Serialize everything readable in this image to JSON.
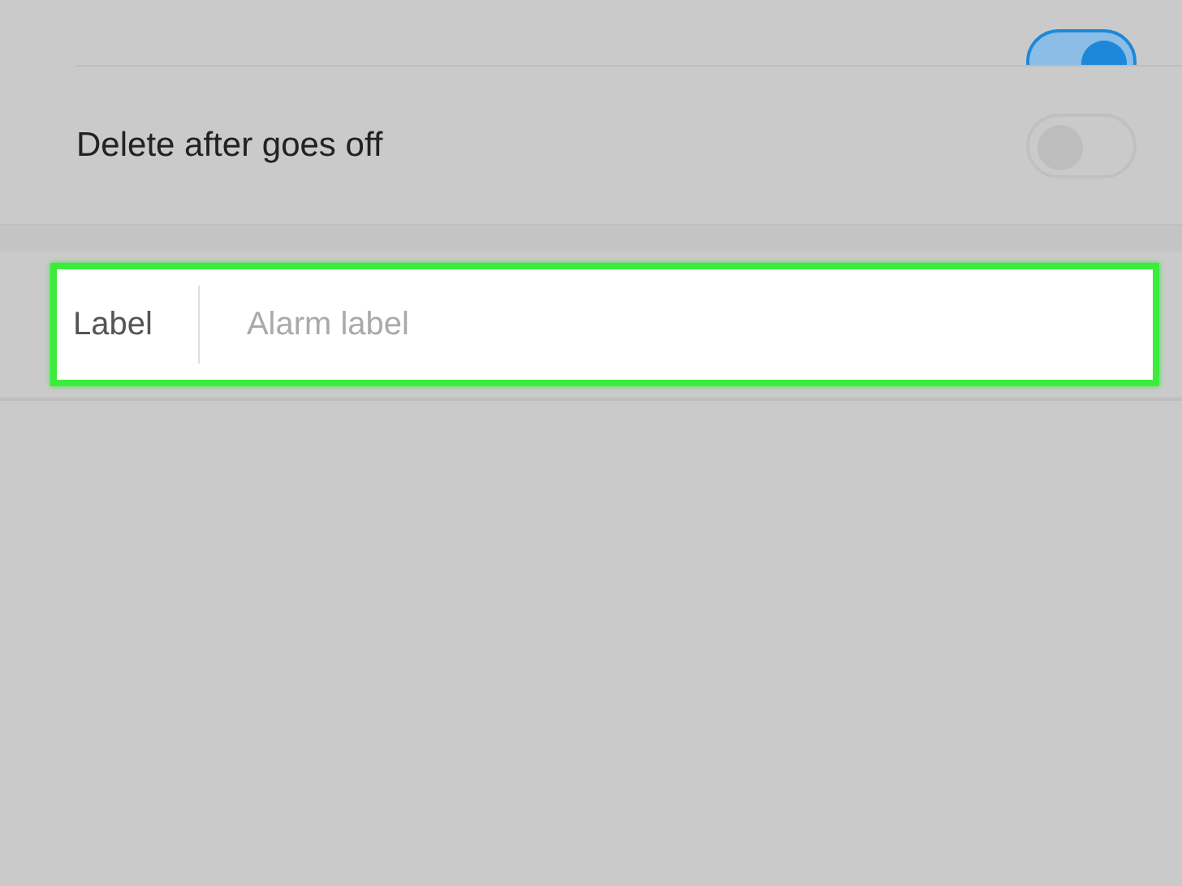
{
  "settings": [
    {
      "kind": "toggle",
      "on": true
    },
    {
      "kind": "toggle",
      "label": "Delete after goes off",
      "on": false
    }
  ],
  "label_field": {
    "label": "Label",
    "placeholder": "Alarm label",
    "highlighted": true
  }
}
